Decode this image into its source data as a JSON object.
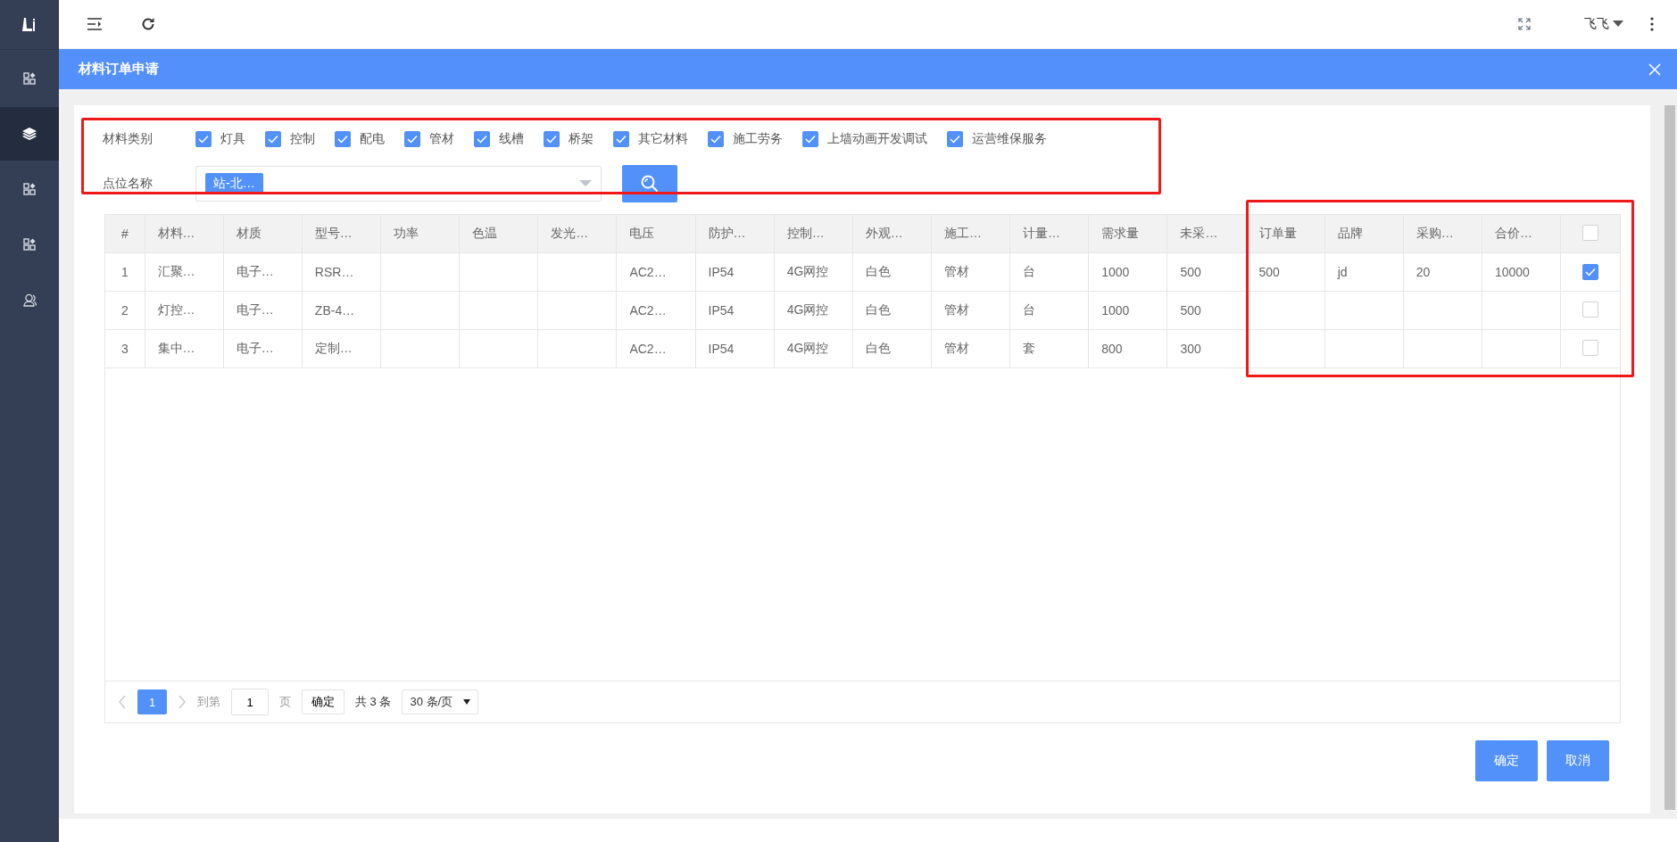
{
  "sidebar": {
    "items": [
      {
        "kind": "grid",
        "selected": false
      },
      {
        "kind": "layers",
        "selected": true
      },
      {
        "kind": "grid",
        "selected": false
      },
      {
        "kind": "grid",
        "selected": false
      },
      {
        "kind": "user",
        "selected": false
      }
    ]
  },
  "topbar": {
    "user_name": "飞飞"
  },
  "dialog": {
    "title": "材料订单申请"
  },
  "filter": {
    "category_label": "材料类别",
    "categories": [
      {
        "label": "灯具",
        "checked": true
      },
      {
        "label": "控制",
        "checked": true
      },
      {
        "label": "配电",
        "checked": true
      },
      {
        "label": "管材",
        "checked": true
      },
      {
        "label": "线槽",
        "checked": true
      },
      {
        "label": "桥架",
        "checked": true
      },
      {
        "label": "其它材料",
        "checked": true
      },
      {
        "label": "施工劳务",
        "checked": true
      },
      {
        "label": "上墙动画开发调试",
        "checked": true
      },
      {
        "label": "运营维保服务",
        "checked": true
      }
    ],
    "point_label": "点位名称",
    "point_tags": [
      "站-北…"
    ]
  },
  "table": {
    "columns": [
      "#",
      "材料…",
      "材质",
      "型号…",
      "功率",
      "色温",
      "发光…",
      "电压",
      "防护…",
      "控制…",
      "外观…",
      "施工…",
      "计量…",
      "需求量",
      "未采…",
      "订单量",
      "品牌",
      "采购…",
      "合价…"
    ],
    "header_checked": false,
    "rows": [
      {
        "cells": [
          "1",
          "汇聚…",
          "电子…",
          "RSR…",
          "",
          "",
          "",
          "AC2…",
          "IP54",
          "4G网控",
          "白色",
          "管材",
          "台",
          "1000",
          "500",
          "500",
          "jd",
          "20",
          "10000"
        ],
        "selected": true
      },
      {
        "cells": [
          "2",
          "灯控…",
          "电子…",
          "ZB-4…",
          "",
          "",
          "",
          "AC2…",
          "IP54",
          "4G网控",
          "白色",
          "管材",
          "台",
          "1000",
          "500",
          "",
          "",
          "",
          ""
        ],
        "selected": false
      },
      {
        "cells": [
          "3",
          "集中…",
          "电子…",
          "定制…",
          "",
          "",
          "",
          "AC2…",
          "IP54",
          "4G网控",
          "白色",
          "管材",
          "套",
          "800",
          "300",
          "",
          "",
          "",
          ""
        ],
        "selected": false
      }
    ]
  },
  "pagination": {
    "pages": [
      {
        "label": "1",
        "selected": true
      }
    ],
    "goto_label": "到第",
    "goto_value": "1",
    "page_unit": "页",
    "goto_button": "确定",
    "total": "共 3 条",
    "page_size": "30 条/页"
  },
  "buttons": [
    {
      "label": "确定"
    },
    {
      "label": "取消"
    }
  ]
}
